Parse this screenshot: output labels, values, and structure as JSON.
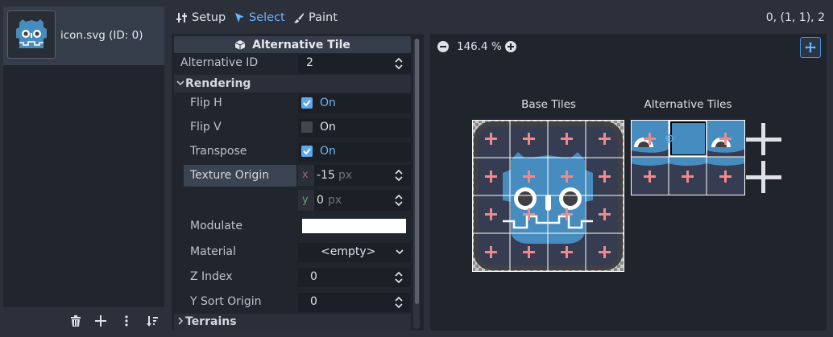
{
  "atlas_list": {
    "items": [
      {
        "label": "icon.svg (ID: 0)"
      }
    ]
  },
  "toolbar": {
    "setup_label": "Setup",
    "select_label": "Select",
    "paint_label": "Paint",
    "coords": "0, (1, 1), 2"
  },
  "inspector": {
    "header": "Alternative Tile",
    "alternative_id_label": "Alternative ID",
    "alternative_id_value": "2",
    "rendering_label": "Rendering",
    "flip_h_label": "Flip H",
    "flip_h_value": "On",
    "flip_v_label": "Flip V",
    "flip_v_value": "On",
    "transpose_label": "Transpose",
    "transpose_value": "On",
    "texture_origin_label": "Texture Origin",
    "origin_x_axis": "x",
    "origin_x_value": "-15",
    "origin_y_axis": "y",
    "origin_y_value": "0",
    "unit": "px",
    "modulate_label": "Modulate",
    "material_label": "Material",
    "material_value": "<empty>",
    "z_index_label": "Z Index",
    "z_index_value": "0",
    "y_sort_label": "Y Sort Origin",
    "y_sort_value": "0",
    "terrains_label": "Terrains"
  },
  "viewport": {
    "zoom": "146.4 %",
    "base_tiles_label": "Base Tiles",
    "alternative_tiles_label": "Alternative Tiles"
  },
  "colors": {
    "accent": "#5fa8ec",
    "background": "#2b303b",
    "panel": "#21252e",
    "godot_blue": "#478cbf"
  }
}
